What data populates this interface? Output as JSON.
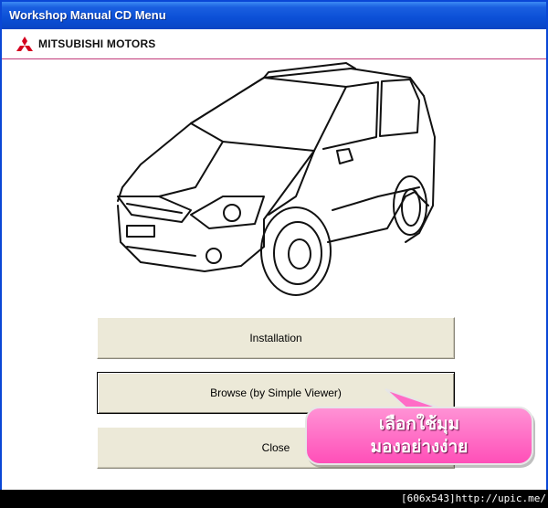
{
  "window": {
    "title": "Workshop Manual CD Menu"
  },
  "header": {
    "brand": "MITSUBISHI MOTORS"
  },
  "buttons": {
    "installation": "Installation",
    "browse": "Browse (by Simple Viewer)",
    "close": "Close"
  },
  "callout": {
    "line1": "เลือกใช้มุม",
    "line2": "มองอย่างง่าย"
  },
  "footer": {
    "text": "[606x543]http://upic.me/"
  },
  "colors": {
    "titlebar": "#0b4fd6",
    "callout": "#ff4fb8",
    "header_rule": "#c23a79",
    "button_face": "#ece9d8"
  }
}
